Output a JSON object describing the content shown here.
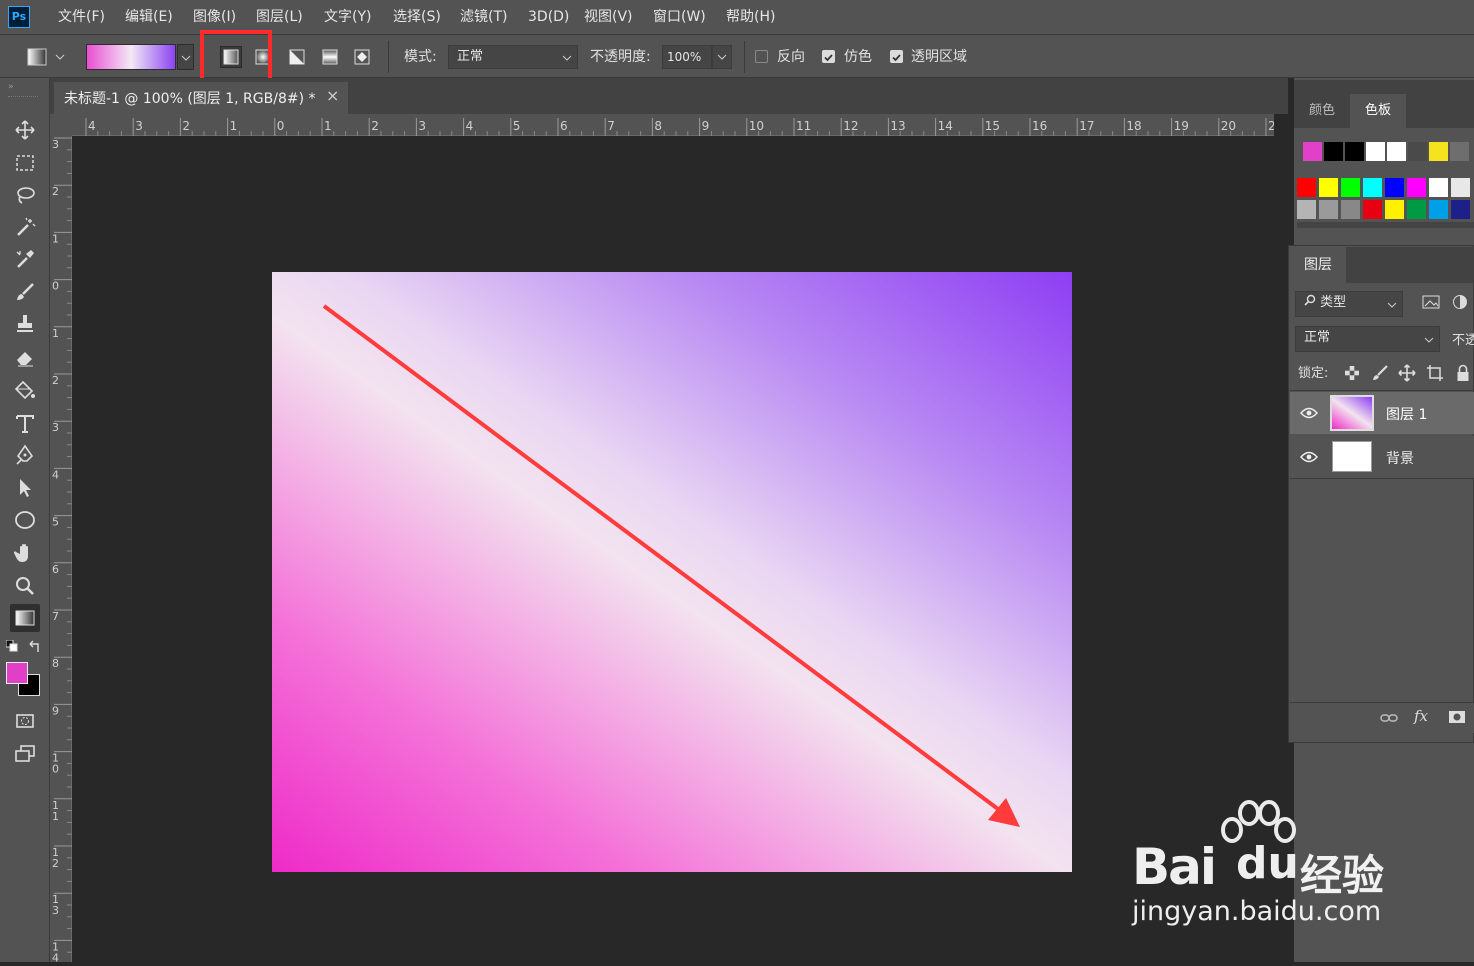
{
  "app": {
    "logo": "Ps"
  },
  "menu": [
    "文件(F)",
    "编辑(E)",
    "图像(I)",
    "图层(L)",
    "文字(Y)",
    "选择(S)",
    "滤镜(T)",
    "3D(D)",
    "视图(V)",
    "窗口(W)",
    "帮助(H)"
  ],
  "options": {
    "gradient_colors": [
      "#e94fd2",
      "#f3e9f6",
      "#8b43f1"
    ],
    "gradient_types": [
      "linear-gradient-icon",
      "radial-gradient-icon",
      "angle-gradient-icon",
      "reflected-gradient-icon",
      "diamond-gradient-icon"
    ],
    "selected_gradient_type": 0,
    "mode_label": "模式:",
    "mode_value": "正常",
    "opacity_label": "不透明度:",
    "opacity_value": "100%",
    "reverse_label": "反向",
    "reverse_checked": false,
    "dither_label": "仿色",
    "dither_checked": true,
    "transparency_label": "透明区域",
    "transparency_checked": true
  },
  "document": {
    "tab_title": "未标题-1 @ 100% (图层 1, RGB/8#) *",
    "close_glyph": "×"
  },
  "ruler": {
    "h_labels": [
      "4",
      "3",
      "2",
      "1",
      "0",
      "1",
      "2",
      "3",
      "4",
      "5",
      "6",
      "7",
      "8",
      "9",
      "10",
      "11",
      "12",
      "13",
      "14",
      "15",
      "16",
      "17",
      "18",
      "19",
      "20",
      "2"
    ],
    "v_labels": [
      "3",
      "2",
      "1",
      "0",
      "1",
      "2",
      "3",
      "4",
      "5",
      "6",
      "7",
      "8",
      "9",
      "1\n0",
      "1\n1",
      "1\n2",
      "1\n3",
      "1\n4"
    ]
  },
  "canvas": {
    "gradient_stops": [
      "#ee2bc8",
      "#f472d8",
      "#f3e3ef",
      "#e9d6f3",
      "#b98bf3",
      "#8e3ef3"
    ],
    "annotation_arrow_color": "#ff3b3b",
    "highlight_box_color": "#ff2a2a"
  },
  "swatches_panel": {
    "tabs": [
      "颜色",
      "色板"
    ],
    "active_tab": 1,
    "recent": [
      "#e240c9",
      "#000000",
      "#000000",
      "#ffffff",
      "#ffffff",
      "#4a4a4a",
      "#f5e31e",
      "#6e6e6e"
    ],
    "row1": [
      "#ff0000",
      "#ffff00",
      "#00ff00",
      "#00ffff",
      "#0000ff",
      "#ff00ff",
      "#ffffff",
      "#e8e8e8"
    ],
    "row2": [
      "#b4b4b4",
      "#9a9a9a",
      "#888888",
      "#e60012",
      "#fff100",
      "#009944",
      "#00a0e9",
      "#1d2088"
    ]
  },
  "layers_panel": {
    "tab": "图层",
    "filter_label": "类型",
    "blend_mode": "正常",
    "opacity_label_partial": "不透",
    "lock_label": "锁定:",
    "layers": [
      {
        "name": "图层 1",
        "selected": true,
        "thumb": "gradient"
      },
      {
        "name": "背景",
        "selected": false,
        "thumb": "white"
      }
    ],
    "footer_icons": [
      "link-icon",
      "fx-icon",
      "mask-icon"
    ]
  },
  "watermark": {
    "brand": "Bai",
    "brand2": "du",
    "suffix": "经验",
    "url": "jingyan.baidu.com"
  }
}
